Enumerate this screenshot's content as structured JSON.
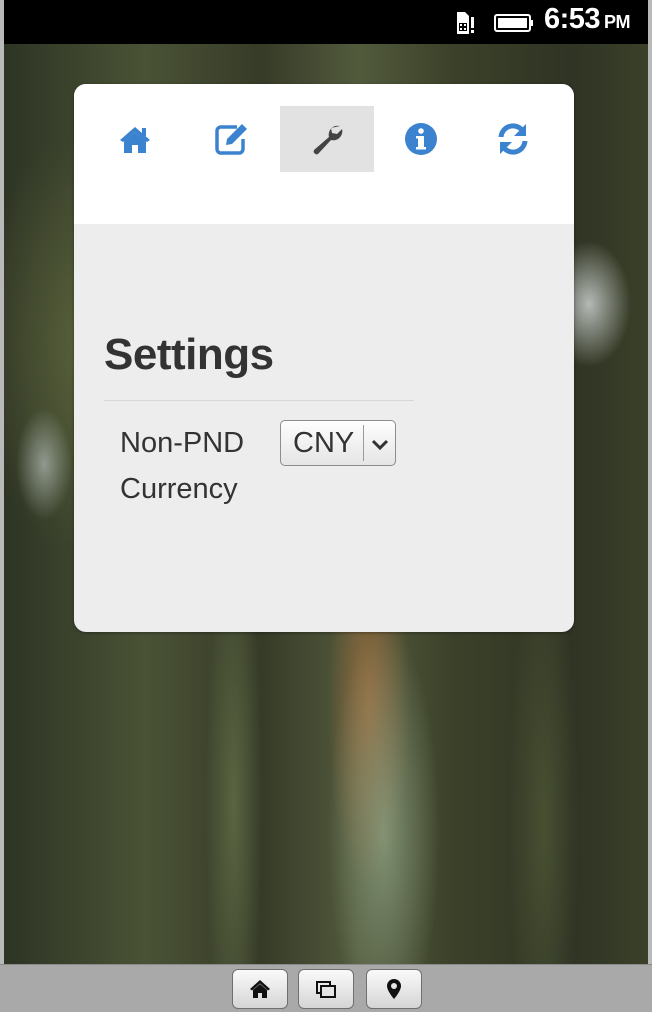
{
  "status_bar": {
    "time": "6:53",
    "ampm": "PM",
    "icons": [
      "sim-alert-icon",
      "battery-icon"
    ]
  },
  "toolbar": {
    "items": [
      {
        "id": "home",
        "icon": "home-icon",
        "active": false
      },
      {
        "id": "edit",
        "icon": "edit-icon",
        "active": false
      },
      {
        "id": "settings",
        "icon": "wrench-icon",
        "active": true
      },
      {
        "id": "info",
        "icon": "info-icon",
        "active": false
      },
      {
        "id": "refresh",
        "icon": "refresh-icon",
        "active": false
      }
    ],
    "icon_color": "#3b82cf",
    "active_icon_color": "#444444"
  },
  "settings": {
    "title": "Settings",
    "field_label": "Non-PND Currency",
    "currency": {
      "selected": "CNY"
    }
  },
  "bottom_bar": {
    "buttons": [
      "home-icon",
      "windows-icon",
      "location-pin-icon"
    ]
  }
}
